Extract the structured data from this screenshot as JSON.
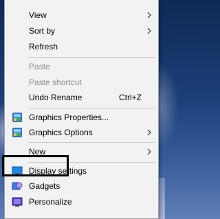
{
  "menu": {
    "view": "View",
    "sort_by": "Sort by",
    "refresh": "Refresh",
    "paste": "Paste",
    "paste_shortcut": "Paste shortcut",
    "undo_rename": "Undo Rename",
    "undo_rename_shortcut": "Ctrl+Z",
    "graphics_properties": "Graphics Properties...",
    "graphics_options": "Graphics Options",
    "new": "New",
    "display_settings": "Display settings",
    "gadgets": "Gadgets",
    "personalize": "Personalize"
  },
  "icons": {
    "graphics_properties": "intel-graphics-icon",
    "graphics_options": "intel-graphics-icon",
    "display_settings": "display-settings-icon",
    "gadgets": "gadgets-icon",
    "personalize": "personalize-icon"
  },
  "colors": {
    "menu_bg": "#f2f2f2",
    "disabled_text": "#8b8b8b",
    "highlight_border": "#000000"
  }
}
